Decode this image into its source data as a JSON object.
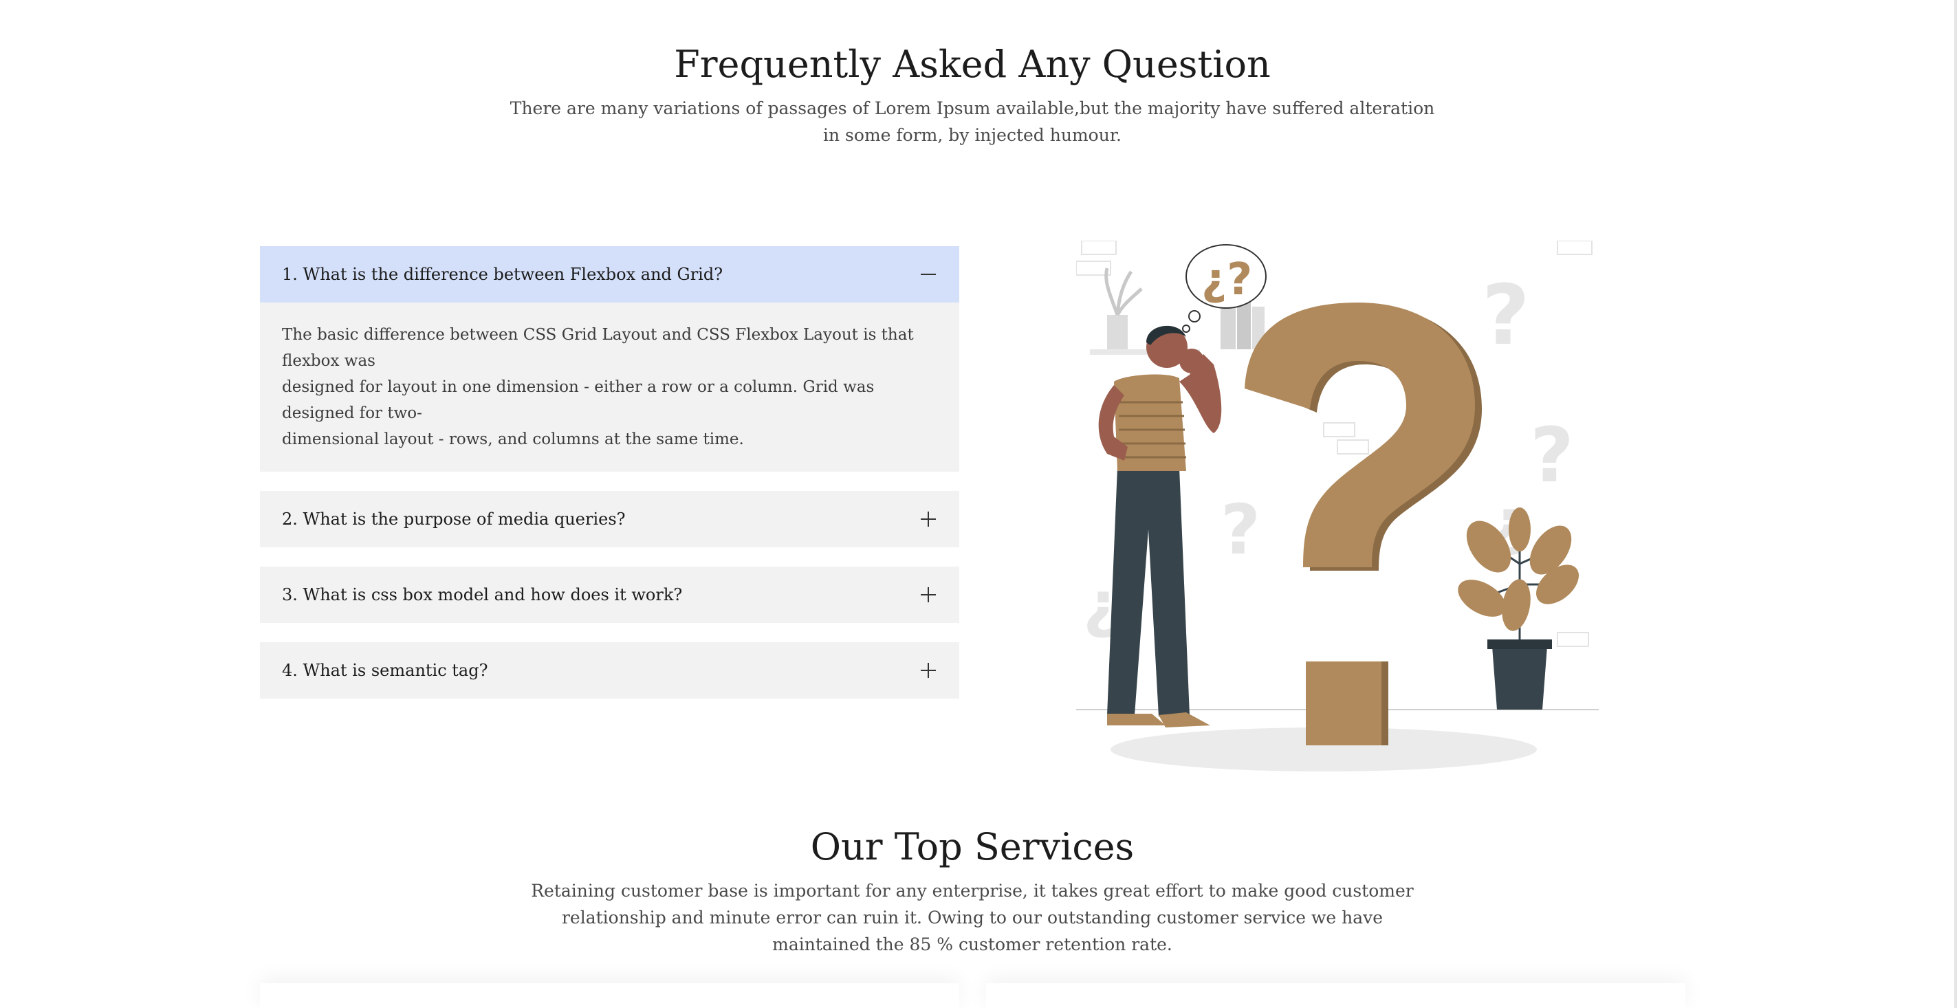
{
  "faq": {
    "title": "Frequently Asked Any Question",
    "subtitle_line1": "There are many variations of passages of Lorem Ipsum available,but the majority have suffered alteration",
    "subtitle_line2": "in some form, by injected humour.",
    "items": [
      {
        "question": "1. What is the difference between Flexbox and Grid?",
        "expanded": true,
        "answer_line1": "The basic difference between CSS Grid Layout and CSS Flexbox Layout is that flexbox was",
        "answer_line2": "designed for layout in one dimension - either a row or a column. Grid was designed for two-",
        "answer_line3": "dimensional layout - rows, and columns at the same time.",
        "icon": "minus-icon"
      },
      {
        "question": "2. What is the purpose of media queries?",
        "expanded": false,
        "icon": "plus-icon"
      },
      {
        "question": "3. What is css box model and how does it work?",
        "expanded": false,
        "icon": "plus-icon"
      },
      {
        "question": "4. What is semantic tag?",
        "expanded": false,
        "icon": "plus-icon"
      }
    ],
    "illustration": {
      "thought_bubble_text": "¿?",
      "accent_color": "#b08a5c",
      "dark_color": "#37444b"
    },
    "colors": {
      "active_header_bg": "#d4e0fa",
      "item_bg": "#f2f2f2"
    }
  },
  "services": {
    "title": "Our Top Services",
    "subtitle_line1": "Retaining customer base is important for any enterprise, it takes great effort to make good customer",
    "subtitle_line2": "relationship and minute error can ruin it. Owing to our outstanding customer service we have",
    "subtitle_line3": "maintained the 85 % customer retention rate."
  }
}
